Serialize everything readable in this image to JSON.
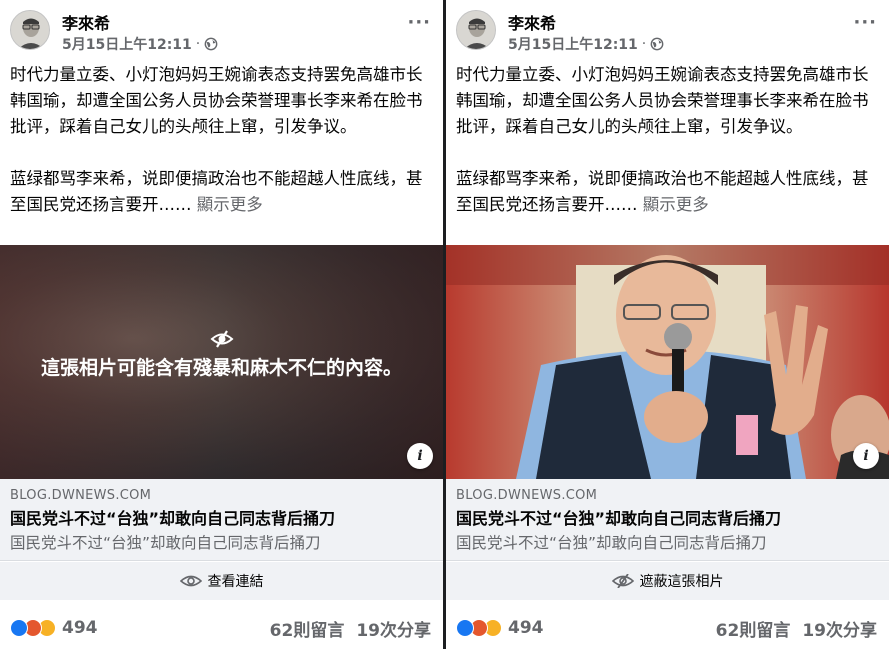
{
  "posts": [
    {
      "author": "李來希",
      "date": "5月15日上午12:11",
      "separator": "·",
      "more_label": "···",
      "body": {
        "para1": "时代力量立委、小灯泡妈妈王婉谕表态支持罢免高雄市长韩国瑜，却遭全国公务人员协会荣誉理事长李来希在脸书批评，踩着自己女儿的头颅往上窜，引发争议。",
        "para2": "蓝绿都骂李来希，说即便搞政治也不能超越人性底线，甚至国民党还扬言要开……",
        "see_more": "顯示更多"
      },
      "media_warning": "這張相片可能含有殘暴和麻木不仁的內容。",
      "info_label": "i",
      "link": {
        "domain": "BLOG.DWNEWS.COM",
        "title": "国民党斗不过“台独”却敢向自己同志背后捅刀",
        "subtitle": "国民党斗不过“台独”却敢向自己同志背后捅刀"
      },
      "action_label": "查看連結",
      "action_icon": "eye-icon",
      "reactions_count": "494",
      "comments": "62則留言",
      "shares": "19次分享"
    },
    {
      "author": "李來希",
      "date": "5月15日上午12:11",
      "separator": "·",
      "more_label": "···",
      "body": {
        "para1": "时代力量立委、小灯泡妈妈王婉谕表态支持罢免高雄市长韩国瑜，却遭全国公务人员协会荣誉理事长李来希在脸书批评，踩着自己女儿的头颅往上窜，引发争议。",
        "para2": "蓝绿都骂李来希，说即便搞政治也不能超越人性底线，甚至国民党还扬言要开……",
        "see_more": "顯示更多"
      },
      "info_label": "i",
      "link": {
        "domain": "BLOG.DWNEWS.COM",
        "title": "国民党斗不过“台独”却敢向自己同志背后捅刀",
        "subtitle": "国民党斗不过“台独”却敢向自己同志背后捅刀"
      },
      "action_label": "遮蔽這張相片",
      "action_icon": "eye-slash-icon",
      "reactions_count": "494",
      "comments": "62則留言",
      "shares": "19次分享"
    }
  ],
  "colors": {
    "like": "#1877f2",
    "angry": "#e4572e",
    "haha": "#f7b125",
    "secondary_text": "#65676b",
    "card_bg": "#f0f2f5"
  }
}
